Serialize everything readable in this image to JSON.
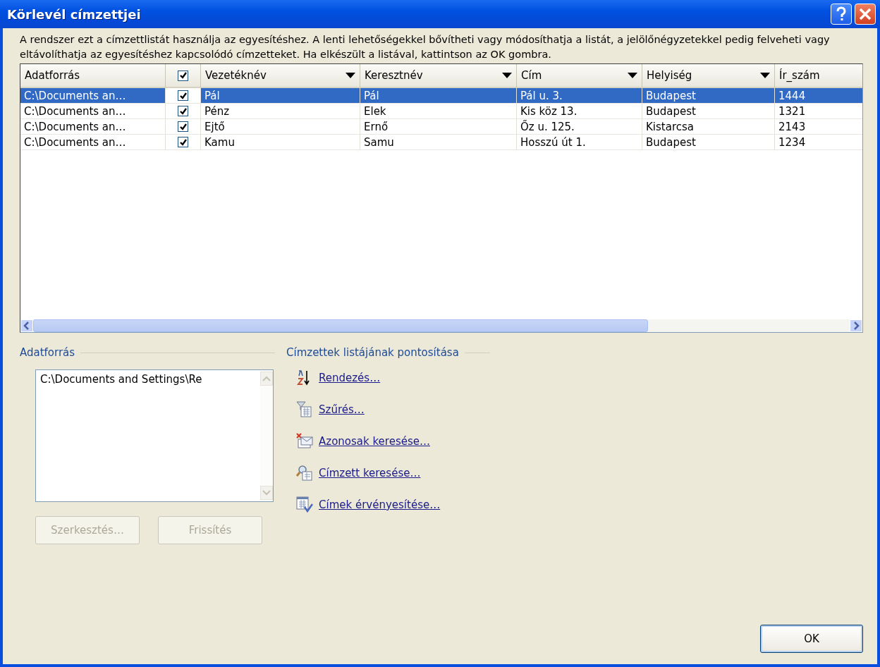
{
  "window": {
    "title": "Körlevél címzettjei"
  },
  "description": "A rendszer ezt a címzettlistát használja az egyesítéshez. A lenti lehetőségekkel bővítheti vagy módosíthatja a listát, a jelölőnégyzetekkel pedig felveheti vagy eltávolíthatja az egyesítéshez kapcsolódó címzetteket. Ha elkészült a listával, kattintson az OK gombra.",
  "table": {
    "header_checked": true,
    "columns": [
      {
        "label": "Adatforrás",
        "dropdown": false
      },
      {
        "label": "Vezetéknév",
        "dropdown": true
      },
      {
        "label": "Keresztnév",
        "dropdown": true
      },
      {
        "label": "Cím",
        "dropdown": true
      },
      {
        "label": "Helyiség",
        "dropdown": true
      },
      {
        "label": "Ír_szám",
        "dropdown": false
      }
    ],
    "rows": [
      {
        "selected": true,
        "checked": true,
        "cells": [
          "C:\\Documents an…",
          "Pál",
          "Pál",
          "Pál u. 3.",
          "Budapest",
          "1444"
        ]
      },
      {
        "selected": false,
        "checked": true,
        "cells": [
          "C:\\Documents an…",
          "Pénz",
          "Elek",
          "Kis köz 13.",
          "Budapest",
          "1321"
        ]
      },
      {
        "selected": false,
        "checked": true,
        "cells": [
          "C:\\Documents an…",
          "Ejtő",
          "Ernő",
          "Őz u. 125.",
          "Kistarcsa",
          "2143"
        ]
      },
      {
        "selected": false,
        "checked": true,
        "cells": [
          "C:\\Documents an…",
          "Kamu",
          "Samu",
          "Hosszú út 1.",
          "Budapest",
          "1234"
        ]
      }
    ]
  },
  "data_source": {
    "title": "Adatforrás",
    "items": [
      "C:\\Documents and Settings\\Re"
    ],
    "buttons": [
      {
        "label": "Szerkesztés…",
        "disabled": true
      },
      {
        "label": "Frissítés",
        "disabled": true
      }
    ]
  },
  "refine": {
    "title": "Címzettek listájának pontosítása",
    "links": [
      {
        "kind": "sort",
        "label": "Rendezés…"
      },
      {
        "kind": "filter",
        "label": "Szűrés…"
      },
      {
        "kind": "duplicates",
        "label": "Azonosak keresése…"
      },
      {
        "kind": "find",
        "label": "Címzett keresése…"
      },
      {
        "kind": "validate",
        "label": "Címek érvényesítése…"
      }
    ]
  },
  "ok_button": "OK"
}
